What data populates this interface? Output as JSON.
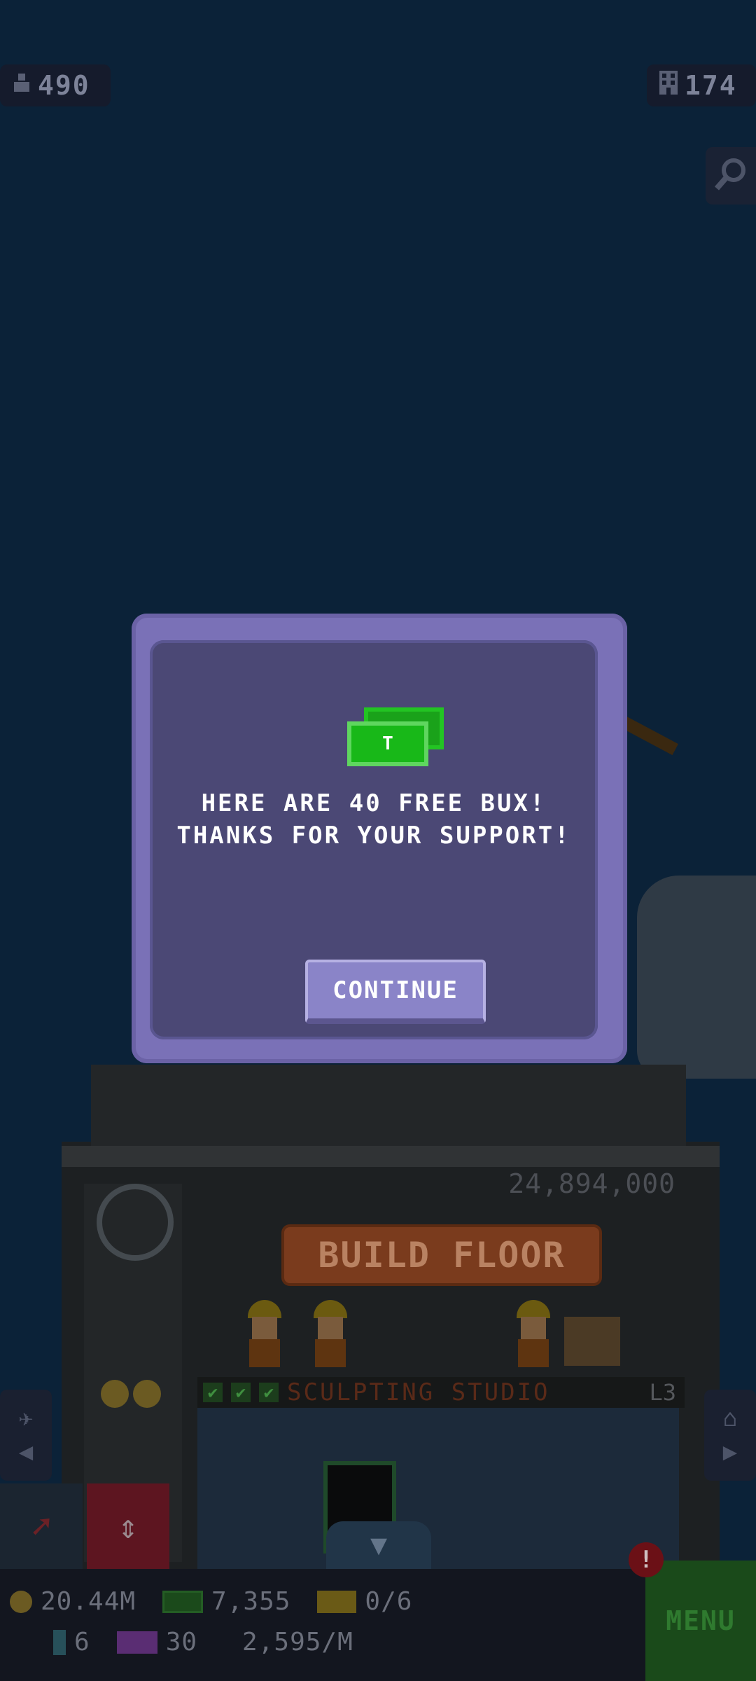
{
  "top_bar": {
    "population": "490",
    "floors": "174",
    "population_icon": "person-icon",
    "floors_icon": "building-icon",
    "zoom_icon": "magnifier-icon"
  },
  "tower": {
    "build_cost": "24,894,000",
    "build_button": "BUILD FLOOR",
    "floor_name": "SCULPTING STUDIO",
    "floor_level": "L3",
    "checks": [
      "✔",
      "✔",
      "✔"
    ]
  },
  "modal": {
    "icon": "bux-icon",
    "line1": "HERE ARE 40 FREE BUX!",
    "line2": "THANKS FOR YOUR SUPPORT!",
    "continue_label": "CONTINUE"
  },
  "status_bar": {
    "coins": "20.44M",
    "bux": "7,355",
    "tickets": "0/6",
    "elevator_count": "6",
    "vip_count": "30",
    "income": "2,595/M",
    "menu_label": "MENU",
    "alert": "!"
  },
  "colors": {
    "background": "#0b2238",
    "modal_frame": "#7a71b7",
    "modal_inner": "#4b4875",
    "bux_green": "#18b818",
    "menu_green": "#1a4a1a"
  }
}
